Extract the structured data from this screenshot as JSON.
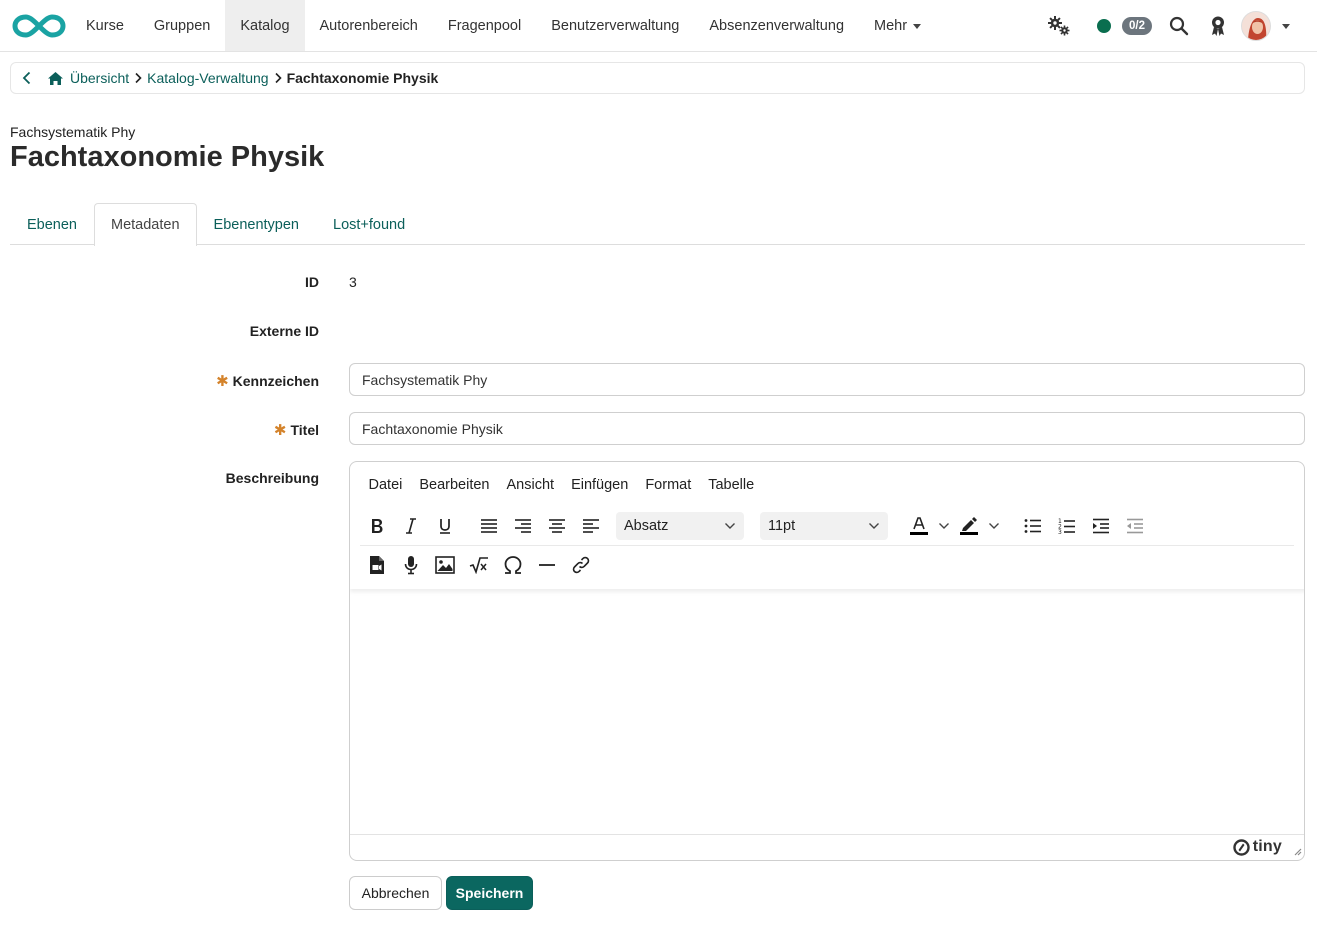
{
  "topnav": {
    "items": [
      {
        "label": "Kurse"
      },
      {
        "label": "Gruppen"
      },
      {
        "label": "Katalog",
        "active": true
      },
      {
        "label": "Autorenbereich"
      },
      {
        "label": "Fragenpool"
      },
      {
        "label": "Benutzerverwaltung"
      },
      {
        "label": "Absenzenverwaltung"
      },
      {
        "label": "Mehr"
      }
    ],
    "badge": "0/2",
    "status_color": "#0a6e4f",
    "accent_color": "#0b6760"
  },
  "breadcrumb": {
    "items": [
      "Übersicht",
      "Katalog-Verwaltung"
    ],
    "current": "Fachtaxonomie Physik"
  },
  "header": {
    "subtitle": "Fachsystematik Phy",
    "title": "Fachtaxonomie Physik"
  },
  "tabs": [
    {
      "label": "Ebenen"
    },
    {
      "label": "Metadaten",
      "active": true
    },
    {
      "label": "Ebenentypen"
    },
    {
      "label": "Lost+found"
    }
  ],
  "form": {
    "id_label": "ID",
    "id_value": "3",
    "external_id_label": "Externe ID",
    "external_id_value": "",
    "kennzeichen_label": "Kennzeichen",
    "kennzeichen_value": "Fachsystematik Phy",
    "titel_label": "Titel",
    "titel_value": "Fachtaxonomie Physik",
    "beschreibung_label": "Beschreibung",
    "required_marker": "✱"
  },
  "editor": {
    "menus": [
      "Datei",
      "Bearbeiten",
      "Ansicht",
      "Einfügen",
      "Format",
      "Tabelle"
    ],
    "block_format": "Absatz",
    "font_size": "11pt",
    "branding": "tiny"
  },
  "actions": {
    "cancel": "Abbrechen",
    "save": "Speichern"
  }
}
